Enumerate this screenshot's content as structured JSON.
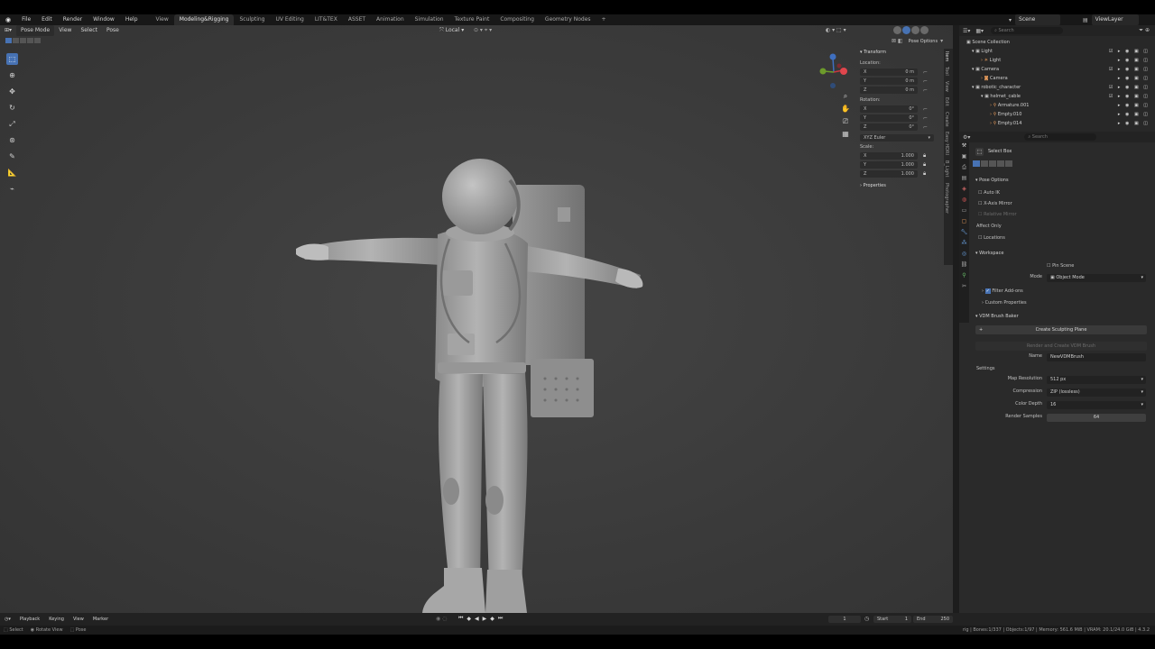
{
  "topbar": {
    "menus": [
      "File",
      "Edit",
      "Render",
      "Window",
      "Help"
    ],
    "workspaces": [
      "View",
      "Modeling&Rigging",
      "Sculpting",
      "UV Editing",
      "LIT&TEX",
      "ASSET",
      "Animation",
      "Simulation",
      "Texture Paint",
      "Compositing",
      "Geometry Nodes"
    ],
    "active_workspace_index": 1,
    "scene": "Scene",
    "view_layer": "ViewLayer"
  },
  "viewport_header": {
    "mode": "Pose Mode",
    "menus": [
      "View",
      "Select",
      "Pose"
    ],
    "orientation": "Local",
    "pose_options": "Pose Options"
  },
  "npanel": {
    "transform_title": "Transform",
    "location_label": "Location:",
    "location": [
      {
        "axis": "X",
        "value": "0 m"
      },
      {
        "axis": "Y",
        "value": "0 m"
      },
      {
        "axis": "Z",
        "value": "0 m"
      }
    ],
    "rotation_label": "Rotation:",
    "rotation": [
      {
        "axis": "X",
        "value": "0°"
      },
      {
        "axis": "Y",
        "value": "0°"
      },
      {
        "axis": "Z",
        "value": "0°"
      }
    ],
    "rotation_mode": "XYZ Euler",
    "scale_label": "Scale:",
    "scale": [
      {
        "axis": "X",
        "value": "1.000"
      },
      {
        "axis": "Y",
        "value": "1.000"
      },
      {
        "axis": "Z",
        "value": "1.000"
      }
    ],
    "properties_label": "Properties",
    "tabs": [
      "Item",
      "Tool",
      "View",
      "Edit",
      "Create",
      "Easy HDRI",
      "B_Light",
      "Photographer"
    ]
  },
  "outliner": {
    "search_placeholder": "Search",
    "rows": [
      {
        "label": "Scene Collection",
        "indent": 0
      },
      {
        "label": "Light",
        "indent": 1
      },
      {
        "label": "Light",
        "indent": 2
      },
      {
        "label": "Camera",
        "indent": 1
      },
      {
        "label": "Camera",
        "indent": 2
      },
      {
        "label": "robotic_character",
        "indent": 1
      },
      {
        "label": "helmet_cable",
        "indent": 2
      },
      {
        "label": "Armature.001",
        "indent": 3
      },
      {
        "label": "Empty.010",
        "indent": 3
      },
      {
        "label": "Empty.014",
        "indent": 3
      }
    ]
  },
  "properties": {
    "search_placeholder": "Search",
    "tool_name": "Select Box",
    "pose_options_title": "Pose Options",
    "auto_ik": "Auto IK",
    "x_axis_mirror": "X-Axis Mirror",
    "relative_mirror": "Relative Mirror",
    "affect_only": "Affect Only",
    "locations": "Locations",
    "workspace_title": "Workspace",
    "pin_scene": "Pin Scene",
    "mode_label": "Mode",
    "mode_value": "Object Mode",
    "filter_addons": "Filter Add-ons",
    "custom_properties": "Custom Properties",
    "vdm_title": "VDM Brush Baker",
    "create_plane_btn": "Create Sculpting Plane",
    "render_create_btn": "Render and Create VDM Brush",
    "name_label": "Name",
    "name_value": "NewVDMBrush",
    "settings_label": "Settings",
    "map_res_label": "Map Resolution",
    "map_res_value": "512 px",
    "compression_label": "Compression",
    "compression_value": "ZIP (lossless)",
    "color_depth_label": "Color Depth",
    "color_depth_value": "16",
    "render_samples_label": "Render Samples",
    "render_samples_value": "64"
  },
  "timeline": {
    "menus": [
      "Playback",
      "Keying",
      "View",
      "Marker"
    ],
    "current_frame": "1",
    "start_label": "Start",
    "start_value": "1",
    "end_label": "End",
    "end_value": "250"
  },
  "statusbar": {
    "select": "Select",
    "rotate": "Rotate View",
    "pose": "Pose",
    "stats": "rig | Bones:1/337 | Objects:1/97 | Memory: 561.6 MiB | VRAM: 20.1/24.0 GiB | 4.3.2"
  }
}
